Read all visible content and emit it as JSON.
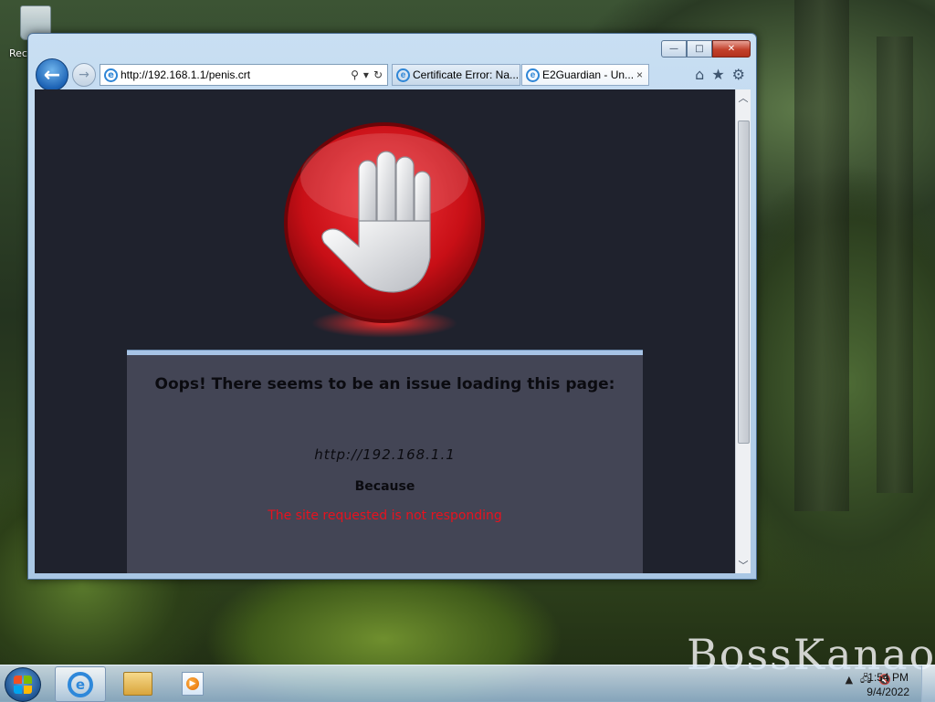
{
  "desktop": {
    "recycle_label": "Rec",
    "watermark": "BossKanao"
  },
  "window": {
    "caption": {
      "minimize": "—",
      "maximize": "□",
      "close": "✕"
    },
    "back_glyph": "←",
    "forward_glyph": "→",
    "address": {
      "url": "http://192.168.1.1/penis.crt",
      "search_glyph": "⚲",
      "dropdown_glyph": "▾",
      "refresh_glyph": "↻"
    },
    "tabs": [
      {
        "label": "Certificate Error: Na...",
        "active": false
      },
      {
        "label": "E2Guardian - Un...",
        "active": true,
        "close": "×"
      }
    ],
    "toolbar_icons": {
      "home": "⌂",
      "favorites": "★",
      "tools": "⚙"
    }
  },
  "page": {
    "title": "Oops! There seems to be an issue loading this page:",
    "url": "http://192.168.1.1",
    "because": "Because",
    "reason": "The site requested is not responding"
  },
  "taskbar": {
    "time": "1:54 PM",
    "date": "9/4/2022",
    "tray_up_glyph": "▲"
  },
  "colors": {
    "viewport_bg": "#1f222d",
    "error_panel_bg": "#434555",
    "reason_text": "#e8121e",
    "stop_red": "#d4141c"
  }
}
